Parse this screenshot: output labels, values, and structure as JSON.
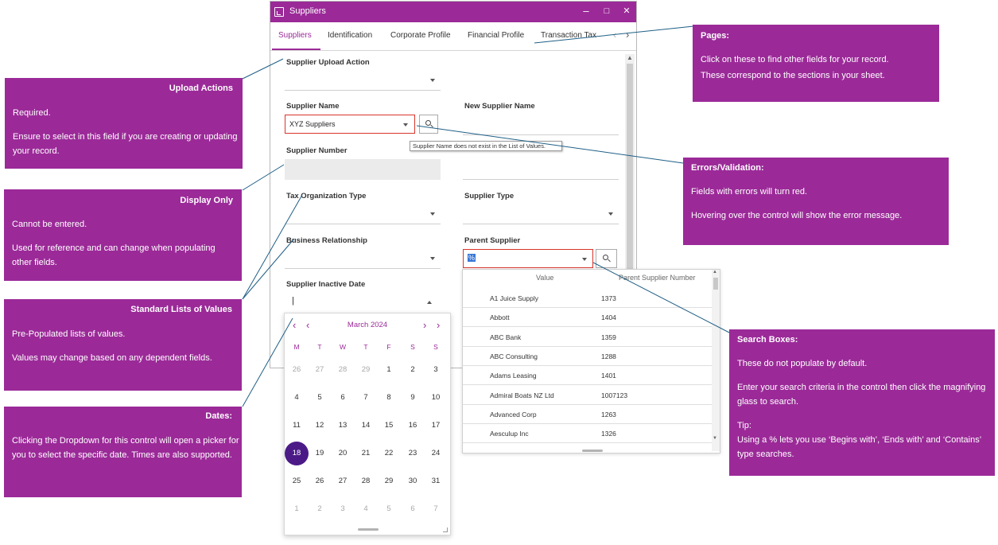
{
  "window": {
    "title": "Suppliers",
    "controls": {
      "minimize": "–",
      "maximize": "□",
      "close": "✕"
    }
  },
  "tabs": [
    "Suppliers",
    "Identification",
    "Corporate Profile",
    "Financial Profile",
    "Transaction Tax"
  ],
  "tab_arrows": {
    "prev": "‹",
    "next": "›"
  },
  "form": {
    "upload_action": {
      "label": "Supplier Upload Action"
    },
    "supplier_name": {
      "label": "Supplier Name",
      "value": "XYZ Suppliers"
    },
    "new_supplier_name": {
      "label": "New Supplier Name"
    },
    "supplier_number": {
      "label": "Supplier Number"
    },
    "tax_org_type": {
      "label": "Tax Organization Type"
    },
    "supplier_type": {
      "label": "Supplier Type"
    },
    "business_relationship": {
      "label": "Business Relationship"
    },
    "parent_supplier": {
      "label": "Parent Supplier",
      "value": "%"
    },
    "inactive_date": {
      "label": "Supplier Inactive Date",
      "value": "|"
    }
  },
  "tooltip": "Supplier Name does not exist in the List of Values.",
  "calendar": {
    "month": "March 2024",
    "nav": {
      "prev_year": "‹",
      "prev_month": "‹",
      "next_month": "›",
      "next_year": "›"
    },
    "weekdays": [
      "M",
      "T",
      "W",
      "T",
      "F",
      "S",
      "S"
    ],
    "weeks": [
      [
        "26",
        "27",
        "28",
        "29",
        "1",
        "2",
        "3"
      ],
      [
        "4",
        "5",
        "6",
        "7",
        "8",
        "9",
        "10"
      ],
      [
        "11",
        "12",
        "13",
        "14",
        "15",
        "16",
        "17"
      ],
      [
        "18",
        "19",
        "20",
        "21",
        "22",
        "23",
        "24"
      ],
      [
        "25",
        "26",
        "27",
        "28",
        "29",
        "30",
        "31"
      ],
      [
        "1",
        "2",
        "3",
        "4",
        "5",
        "6",
        "7"
      ]
    ],
    "selected": "18"
  },
  "results": {
    "headers": [
      "Value",
      "Parent Supplier Number"
    ],
    "rows": [
      [
        "A1 Juice Supply",
        "1373"
      ],
      [
        "Abbott",
        "1404"
      ],
      [
        "ABC Bank",
        "1359"
      ],
      [
        "ABC Consulting",
        "1288"
      ],
      [
        "Adams Leasing",
        "1401"
      ],
      [
        "Admiral Boats NZ Ltd",
        "1007123"
      ],
      [
        "Advanced Corp",
        "1263"
      ],
      [
        "Aesculup Inc",
        "1326"
      ]
    ]
  },
  "callouts": {
    "pages": {
      "title": "Pages:",
      "body": [
        "Click on these to find other fields for your record.",
        "These correspond to the sections in your sheet."
      ]
    },
    "upload": {
      "title": "Upload Actions",
      "body": [
        "Required.",
        "Ensure to select in this field if you are creating or updating your record."
      ]
    },
    "display": {
      "title": "Display Only",
      "body": [
        "Cannot be entered.",
        "Used for reference and can change when populating other fields."
      ]
    },
    "lists": {
      "title": "Standard Lists of Values",
      "body": [
        "Pre-Populated lists of values.",
        "Values may change based on any dependent fields."
      ]
    },
    "dates": {
      "title": "Dates:",
      "body": [
        "Clicking the Dropdown for this control will open a picker for you to select the specific date. Times are also supported."
      ]
    },
    "errors": {
      "title": "Errors/Validation:",
      "body": [
        "Fields with errors will turn red.",
        "Hovering over the control will show the error message."
      ]
    },
    "search": {
      "title": "Search Boxes:",
      "body": [
        "These do not populate by default.",
        "Enter your search criteria in the control then click the magnifying glass to search.",
        "Tip:",
        "Using a % lets you use ‘Begins with’, ‘Ends with’ and ‘Contains’ type searches."
      ]
    }
  },
  "colors": {
    "accent": "#9b2a98",
    "selected_day": "#4b1a87",
    "error": "#d9342b"
  }
}
